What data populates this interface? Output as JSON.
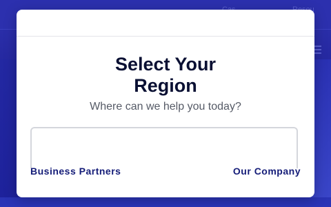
{
  "background": {
    "header_links": [
      "Cas",
      "Resou"
    ]
  },
  "modal": {
    "title_line1": "Select Your",
    "title_line2": "Region",
    "subtitle": "Where can we help you today?",
    "region_select_value": "",
    "links": {
      "left": "Business Partners",
      "right": "Our Company"
    }
  },
  "colors": {
    "title": "#0a1033",
    "link": "#141c78",
    "backdrop": "#2a2fa8"
  }
}
